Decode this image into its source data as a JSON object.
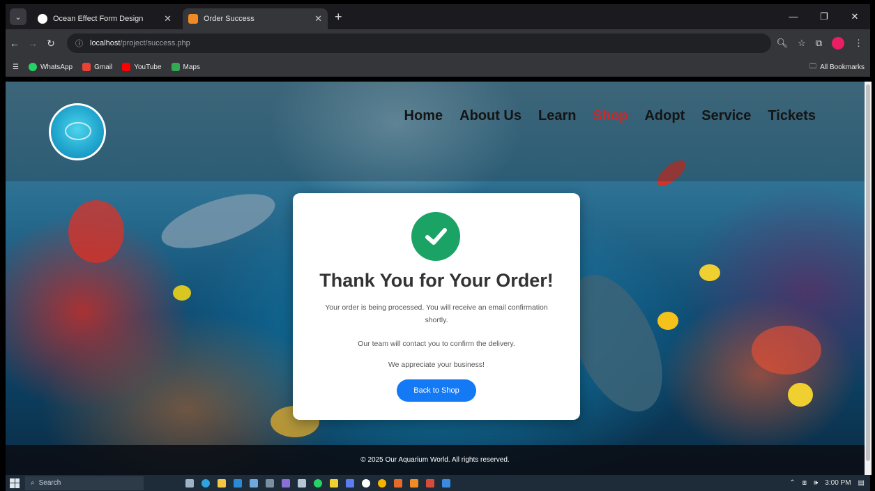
{
  "browser": {
    "tabs": [
      {
        "title": "Ocean Effect Form Design",
        "active": false,
        "favicon_color": "#ffffff"
      },
      {
        "title": "Order Success",
        "active": true,
        "favicon_color": "#f08a24"
      }
    ],
    "new_tab_glyph": "+",
    "url_host": "localhost",
    "url_path": "/project/success.php",
    "bookmarks": [
      {
        "label": "WhatsApp",
        "color": "#25d366"
      },
      {
        "label": "Gmail",
        "color": "#ea4335"
      },
      {
        "label": "YouTube",
        "color": "#ff0000"
      },
      {
        "label": "Maps",
        "color": "#34a853"
      }
    ],
    "all_bookmarks": "All Bookmarks"
  },
  "site": {
    "nav": [
      {
        "label": "Home",
        "active": false
      },
      {
        "label": "About Us",
        "active": false
      },
      {
        "label": "Learn",
        "active": false
      },
      {
        "label": "Shop",
        "active": true
      },
      {
        "label": "Adopt",
        "active": false
      },
      {
        "label": "Service",
        "active": false
      },
      {
        "label": "Tickets",
        "active": false
      }
    ],
    "accent_color": "#d32626"
  },
  "confirmation": {
    "heading": "Thank You for Your Order!",
    "message_1": "Your order is being processed. You will receive an email confirmation shortly.",
    "message_2": "Our team will contact you to confirm the delivery.",
    "message_3": "We appreciate your business!",
    "button_label": "Back to Shop",
    "check_color": "#1aa365",
    "button_color": "#1479f5"
  },
  "footer": {
    "text": "© 2025 Our Aquarium World. All rights reserved."
  },
  "taskbar": {
    "search_placeholder": "Search",
    "time": "3:00 PM"
  }
}
